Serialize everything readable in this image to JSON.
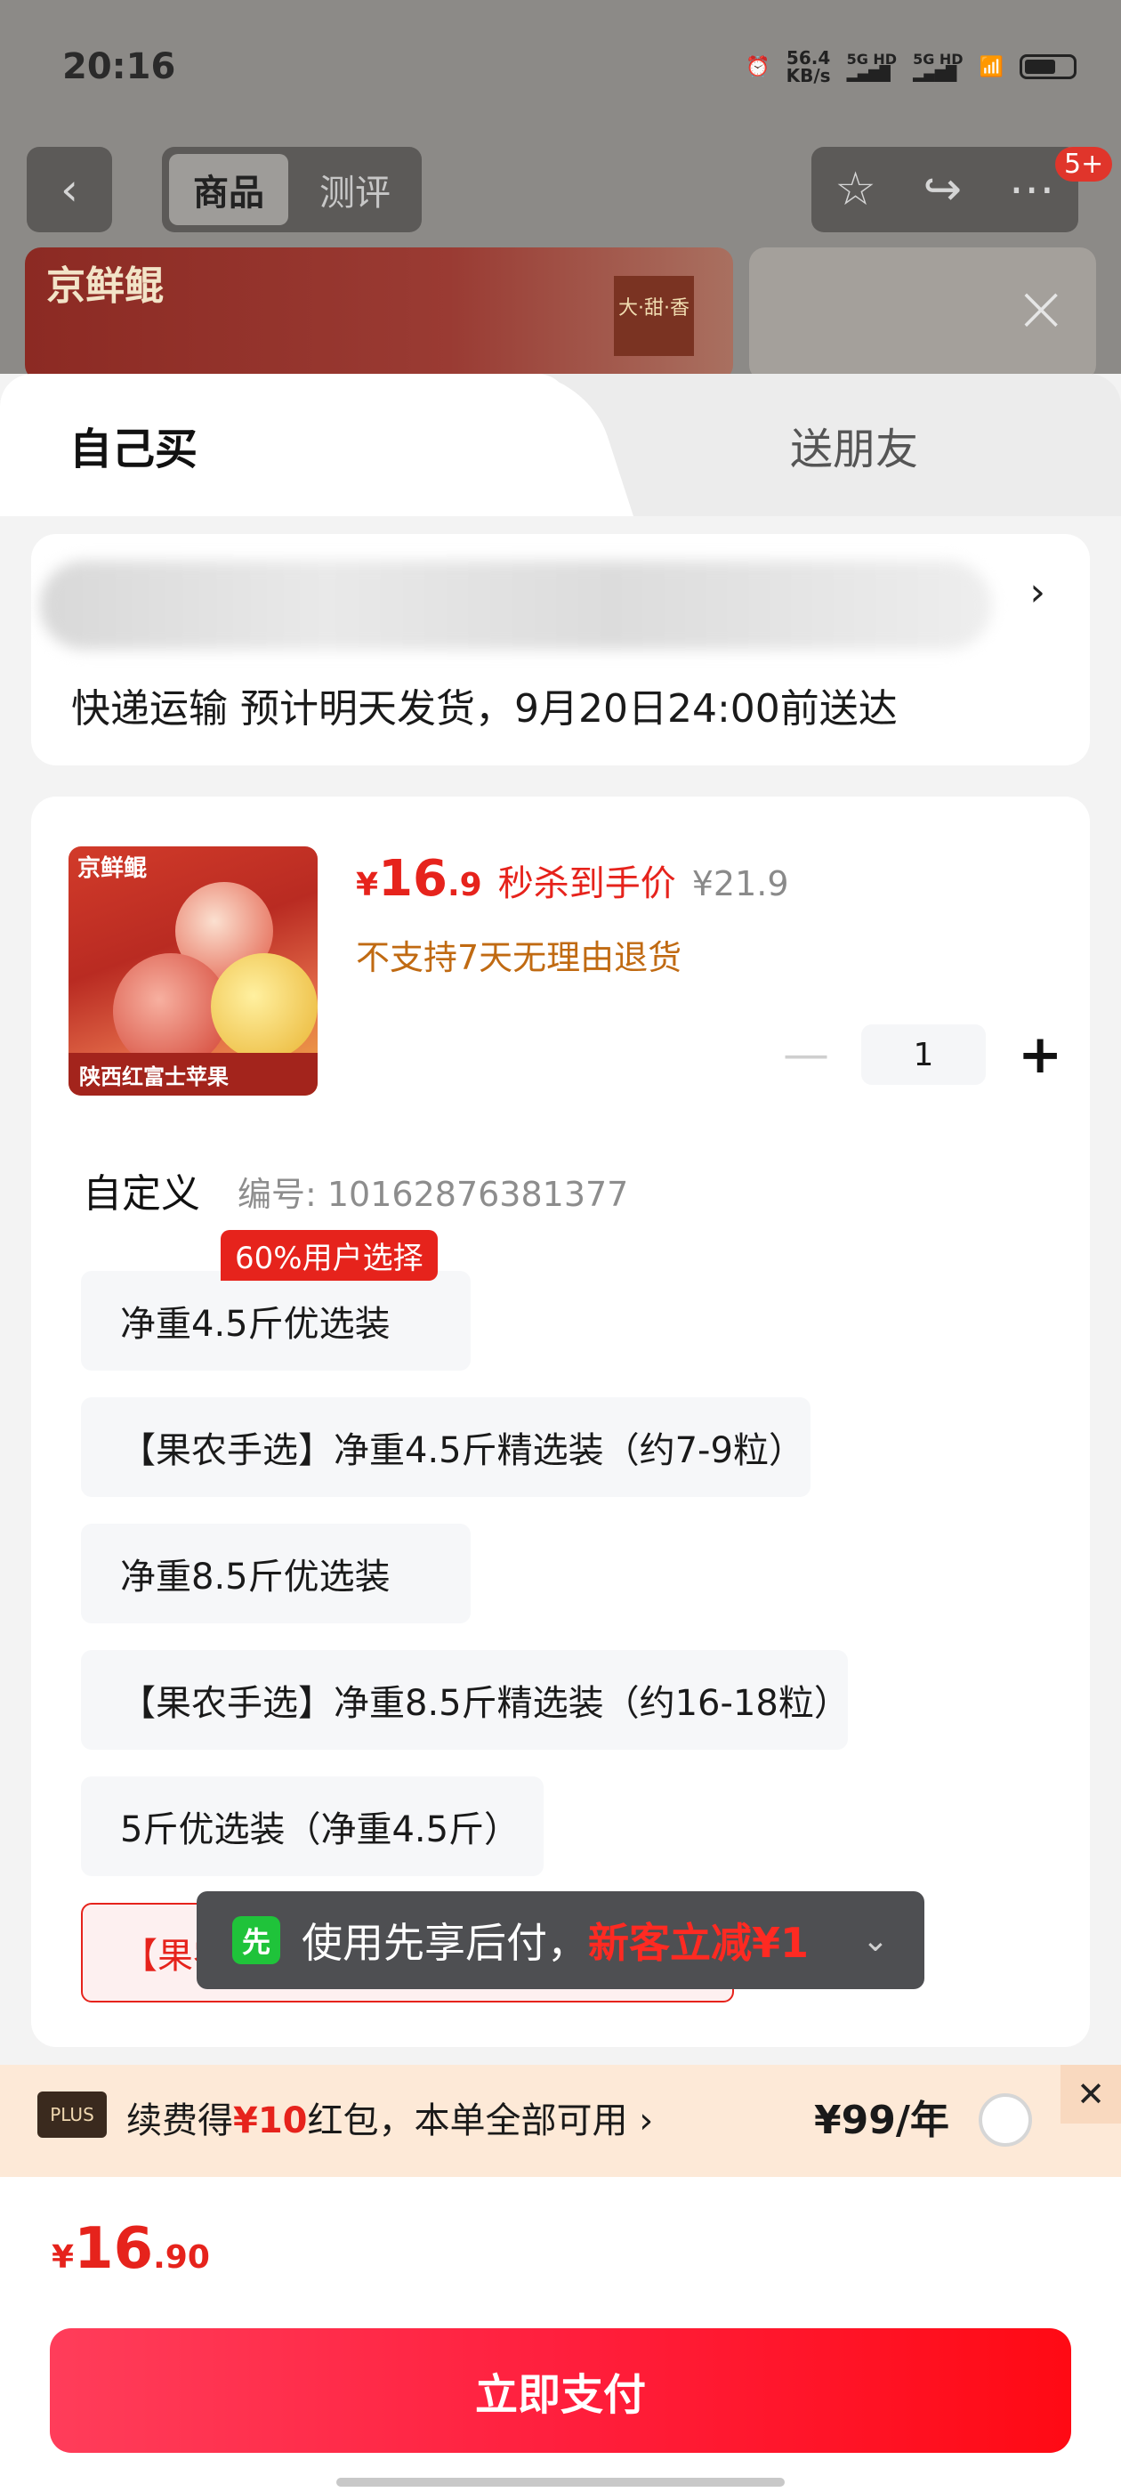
{
  "status_bar": {
    "time": "20:16",
    "net_speed": "56.4",
    "net_unit": "KB/s",
    "sig1": "5G HD",
    "sig2": "5G HD"
  },
  "header": {
    "tabs": [
      "商品",
      "测评"
    ],
    "badge": "5+",
    "banner_brand": "京鲜鲲",
    "banner_tag": "大·甜·香"
  },
  "sheet": {
    "tab_self": "自己买",
    "tab_gift": "送朋友",
    "shipping_text": "快递运输 预计明天发货，9月20日24:00前送达"
  },
  "product": {
    "thumb_brand": "京鲜鲲",
    "thumb_caption": "陕西红富士苹果",
    "price_currency": "¥",
    "price_int": "16",
    "price_dec": ".9",
    "price_label": "秒杀到手价",
    "original_price": "¥21.9",
    "return_policy": "不支持7天无理由退货",
    "quantity": "1"
  },
  "spec": {
    "title": "自定义",
    "code": "编号: 10162876381377",
    "hot_tag": "60%用户选择",
    "options": [
      "净重4.5斤优选装",
      "【果农手选】净重4.5斤精选装（约7-9粒）",
      "净重8.5斤优选装",
      "【果农手选】净重8.5斤精选装（约16-18粒）",
      "5斤优选装（净重4.5斤）",
      "【果农"
    ]
  },
  "toast": {
    "icon": "先",
    "text": "使用先享后付，",
    "highlight": "新客立减¥1"
  },
  "plus": {
    "logo": "PLUS",
    "text_pre": "续费得",
    "text_red": "¥10",
    "text_post": "红包，本单全部可用",
    "price": "¥99/年"
  },
  "total": {
    "currency": "¥",
    "int": "16",
    "dec": ".90"
  },
  "pay_button": "立即支付",
  "colors": {
    "accent": "#e6231c",
    "return_policy": "#c06a12",
    "pay_gradient_end": "#ff0a14"
  }
}
